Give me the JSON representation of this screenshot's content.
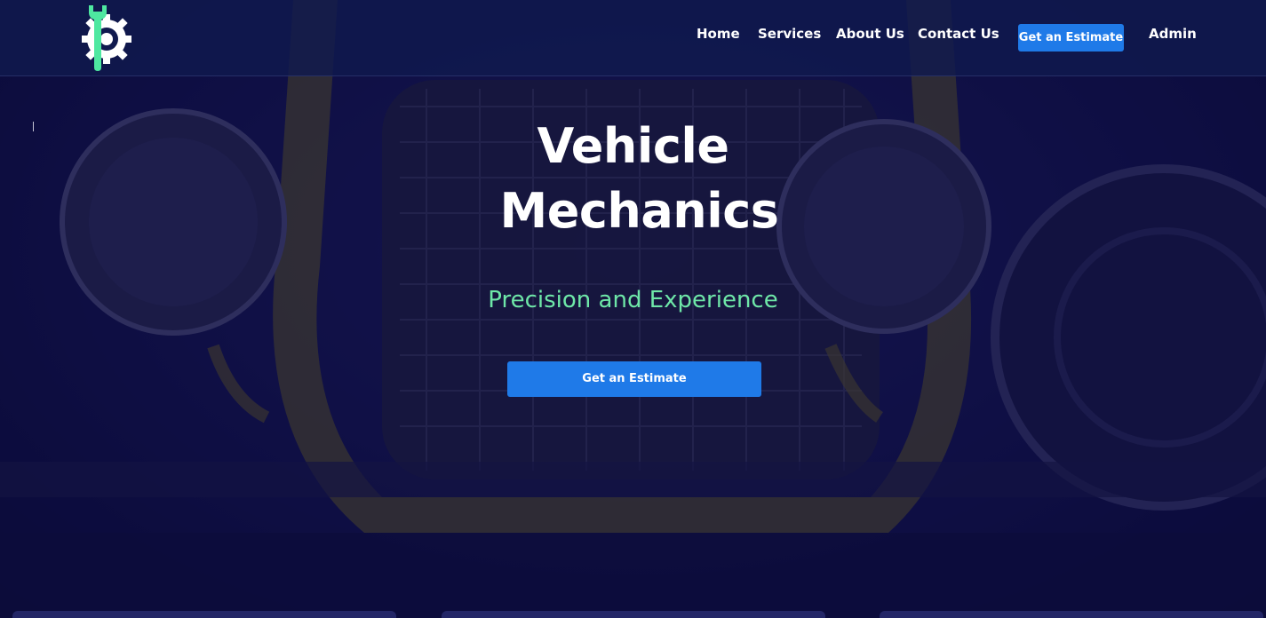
{
  "header": {
    "logo_icon": "wrench-gear-logo-icon",
    "nav": {
      "home": "Home",
      "services": "Services",
      "about": "About Us",
      "contact": "Contact Us",
      "estimate": "Get an Estimate",
      "admin": "Admin"
    }
  },
  "hero": {
    "title": "Vehicle Mechanics",
    "subtitle": "Precision and Experience",
    "cta": "Get an Estimate",
    "background": "vintage car front headlights and grille"
  },
  "colors": {
    "accent_blue": "#1f7ae8",
    "accent_green": "#6ee7a8",
    "header_bg": "#101a4e",
    "page_bg": "#0a0a3a"
  }
}
